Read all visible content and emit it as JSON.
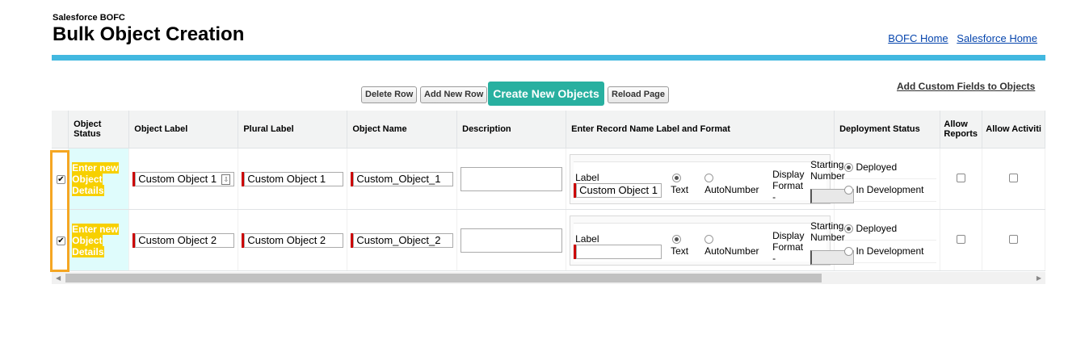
{
  "header": {
    "app_name": "Salesforce BOFC",
    "title": "Bulk Object Creation",
    "links": [
      "BOFC Home",
      "Salesforce Home"
    ]
  },
  "toolbar": {
    "delete_row": "Delete Row",
    "add_new_row": "Add New Row",
    "create_objects": "Create New Objects",
    "reload_page": "Reload Page",
    "add_custom_fields": "Add Custom Fields to Objects"
  },
  "table": {
    "columns": [
      "Object Status",
      "Object Label",
      "Plural Label",
      "Object Name",
      "Description",
      "Enter Record Name Label and Format",
      "Deployment Status",
      "Allow Reports",
      "Allow Activiti"
    ],
    "rows": [
      {
        "checked": true,
        "status": "Enter new Object Details",
        "object_label": "Custom Object 1",
        "plural_label": "Custom Object 1",
        "object_name": "Custom_Object_1",
        "description": "",
        "record_label_caption": "Label",
        "record_label_value": "Custom Object 1",
        "type_text": "Text",
        "type_autonumber": "AutoNumber",
        "type_selected": "Text",
        "display_format": "Display Format -",
        "starting_number": "Starting Number",
        "deploy_options": [
          "Deployed",
          "In Development"
        ],
        "deploy_selected": "Deployed",
        "allow_reports": false,
        "allow_activities": false
      },
      {
        "checked": true,
        "status": "Enter new Object Details",
        "object_label": "Custom Object 2",
        "plural_label": "Custom Object 2",
        "object_name": "Custom_Object_2",
        "description": "",
        "record_label_caption": "Label",
        "record_label_value": "",
        "type_text": "Text",
        "type_autonumber": "AutoNumber",
        "type_selected": "Text",
        "display_format": "Display Format -",
        "starting_number": "Starting Number",
        "deploy_options": [
          "Deployed",
          "In Development"
        ],
        "deploy_selected": "Deployed",
        "allow_reports": false,
        "allow_activities": false
      }
    ]
  },
  "colors": {
    "accent_bar": "#42b8e0",
    "primary_button": "#28b0a0",
    "highlight": "#f7d000",
    "annotation": "#f5a623"
  }
}
